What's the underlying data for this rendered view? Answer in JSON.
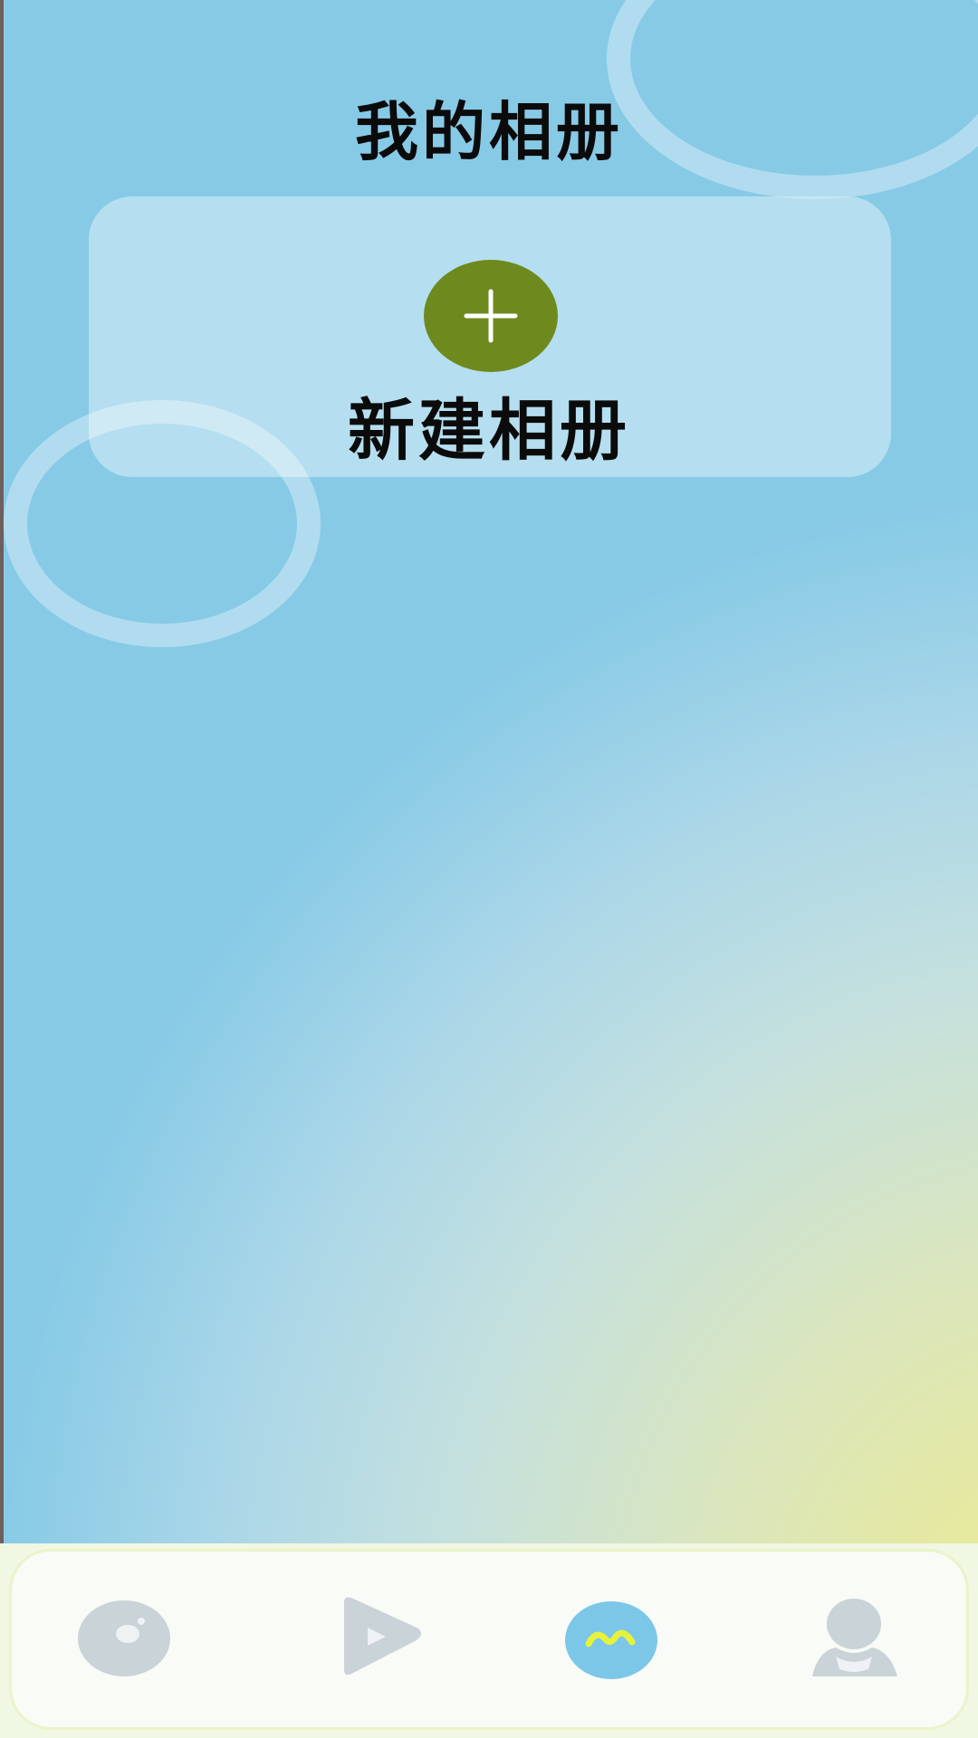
{
  "header": {
    "title": "我的相册"
  },
  "album_card": {
    "add_icon": "plus-icon",
    "label": "新建相册"
  },
  "tabbar": {
    "items": [
      {
        "icon": "music-disc-icon",
        "active": false
      },
      {
        "icon": "play-icon",
        "active": false
      },
      {
        "icon": "album-wave-icon",
        "active": true
      },
      {
        "icon": "profile-icon",
        "active": false
      }
    ],
    "inactive_color": "#c7d2d8",
    "active_color": "#7cc7e8",
    "active_accent": "#e8f23a"
  },
  "colors": {
    "add_button": "#6e8a1f",
    "text": "#0b0b0b"
  }
}
